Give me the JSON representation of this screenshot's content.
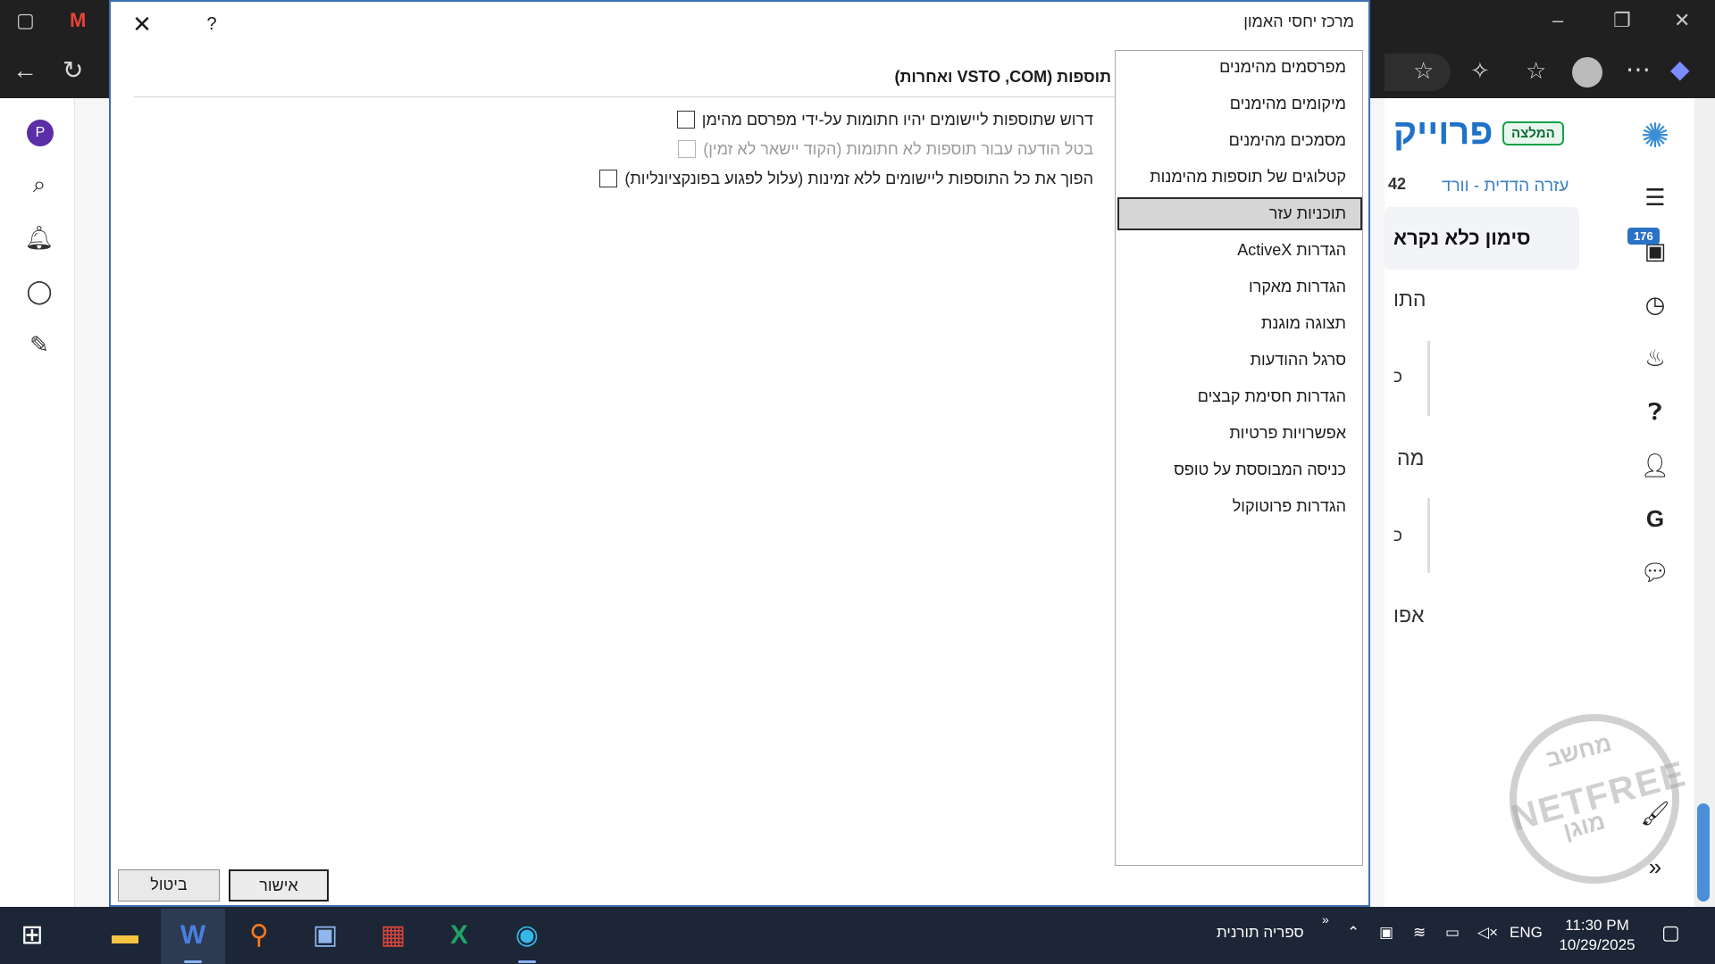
{
  "browser": {
    "titlebar_icons": [
      "tab-actions-icon",
      "gmail-icon",
      "minimize-icon",
      "restore-icon",
      "close-icon"
    ],
    "nav_icons": [
      "back-icon",
      "refresh-icon",
      "star-icon",
      "extensions-icon",
      "favorites-icon",
      "profile-icon",
      "more-icon",
      "copilot-icon"
    ],
    "left_strip": [
      "P"
    ],
    "site": {
      "title": "פרוייק",
      "badge": "המלצה",
      "subtitle": "עזרה הדדית - וורד",
      "count": "42",
      "mark_all": "סימון כלא נקרא",
      "frag_1": "התו",
      "frag_2": "כ",
      "frag_3": "מה",
      "frag_4": "כ",
      "frag_5": "אפו",
      "inbox_badge": "176",
      "watermark": "NETFREE",
      "watermark_top": "מחשב",
      "watermark_bottom": "מוגן"
    }
  },
  "dialog": {
    "title": "מרכז יחסי האמון",
    "help": "?",
    "close": "✕",
    "categories": [
      "מפרסמים מהימנים",
      "מיקומים מהימנים",
      "מסמכים מהימנים",
      "קטלוגים של תוספות מהימנות",
      "תוכניות עזר",
      "הגדרות ActiveX",
      "הגדרות מאקרו",
      "תצוגה מוגנת",
      "סרגל ההודעות",
      "הגדרות חסימת קבצים",
      "אפשרויות פרטיות",
      "כניסה המבוססת על טופס",
      "הגדרות פרוטוקול"
    ],
    "selected_category": "תוכניות עזר",
    "section_title": "תוספות (VSTO ,COM ואחרות)",
    "options": [
      {
        "label": "דרוש שתוספות ליישומים יהיו חתומות על-ידי מפרסם מהימן",
        "checked": false,
        "enabled": true
      },
      {
        "label": "בטל הודעה עבור תוספות לא חתומות (הקוד יישאר לא זמין)",
        "checked": false,
        "enabled": false
      },
      {
        "label": "הפוך את כל התוספות ליישומים ללא זמינות (עלול לפגוע בפונקציונליות)",
        "checked": false,
        "enabled": true
      }
    ],
    "ok_label": "אישור",
    "cancel_label": "ביטול"
  },
  "taskbar": {
    "apps": [
      "start-icon",
      "file-explorer-icon",
      "word-icon",
      "search-app-icon",
      "remote-desktop-icon",
      "library-app-icon",
      "excel-icon",
      "edge-icon"
    ],
    "tray_label": "ספריה תורנית",
    "tray_chevron": "»",
    "language": "ENG",
    "time": "11:30 PM",
    "date": "10/29/2025"
  }
}
